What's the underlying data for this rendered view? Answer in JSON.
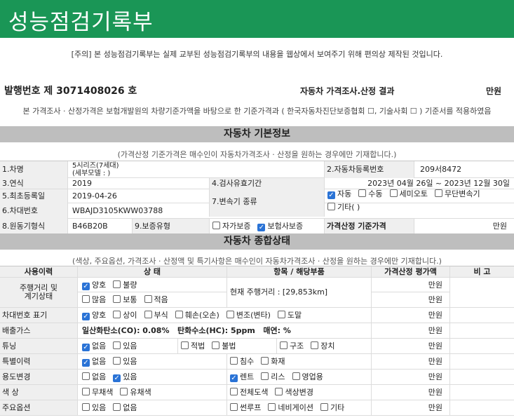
{
  "title": "성능점검기록부",
  "notice": "[주의] 본 성능점검기록부는 실제 교부된 성능점검기록부의 내용을 웹상에서 보여주기 위해 편의상 제작된 것입니다.",
  "issue_no": "발행번호 제 3071408026 호",
  "price_result_title": "자동차 가격조사.산정 결과",
  "won": "만원",
  "basis": "본 가격조사 · 산정가격은 보험개발원의 차량기준가액을 바탕으로 한 기준가격과 ( 한국자동차진단보증협회 ☐, 기술사회 ☐ ) 기준서를 적용하였음",
  "basic": {
    "title": "자동차 기본정보",
    "note": "(가격산정 기준가격은 매수인이 자동차가격조사 · 산정을 원하는 경우에만 기재합니다.)",
    "car_name_label": "1.차명",
    "car_name_1": "5시리즈(7세대)",
    "car_name_2": "(세부모델 : )",
    "reg_no_label": "2.자동차등록번호",
    "reg_no": "209서8472",
    "year_label": "3.연식",
    "year": "2019",
    "valid_label": "4.검사유효기간",
    "valid": "2023년 04월 26일 ~ 2023년 12월 30일",
    "first_reg_label": "5.최초등록일",
    "first_reg": "2019-04-26",
    "trans_label": "7.변속기 종류",
    "trans_opts": [
      {
        "t": "자동",
        "on": true
      },
      {
        "t": "수동",
        "on": false
      },
      {
        "t": "세미오토",
        "on": false
      },
      {
        "t": "무단변속기",
        "on": false
      },
      {
        "t": "기타( )",
        "on": false
      }
    ],
    "vin_label": "6.차대번호",
    "vin": "WBAJD3105KWW03788",
    "engine_label": "8.원동기형식",
    "engine": "B46B20B",
    "warranty_label": "9.보증유형",
    "warranty_opts": [
      {
        "t": "자가보증",
        "on": false
      },
      {
        "t": "보험사보증",
        "on": true
      }
    ],
    "base_price_label": "가격산정 기준가격",
    "base_price_unit": "만원"
  },
  "status": {
    "title": "자동차 종합상태",
    "note": "(색상, 주요옵션, 가격조사 · 산정액 및 특기사항은 매수인이 자동차가격조사 · 산정을 원하는 경우에만 기재합니다.)",
    "headers": [
      "사용이력",
      "상 태",
      "항목 / 해당부품",
      "가격산정 평가액",
      "비 고"
    ],
    "unit": "만원",
    "mileage_label_1": "주행거리 및",
    "mileage_label_2": "계기상태",
    "mileage_opts_a": [
      {
        "t": "양호",
        "on": true
      },
      {
        "t": "불량",
        "on": false
      }
    ],
    "mileage_opts_b": [
      {
        "t": "많음",
        "on": false
      },
      {
        "t": "보통",
        "on": false
      },
      {
        "t": "적음",
        "on": false
      }
    ],
    "mileage_text": "현재 주행거리 : [29,853km]",
    "vin_mark_label": "차대번호 표기",
    "vin_mark_opts": [
      {
        "t": "양호",
        "on": true
      },
      {
        "t": "상이",
        "on": false
      },
      {
        "t": "부식",
        "on": false
      },
      {
        "t": "훼손(오손)",
        "on": false
      },
      {
        "t": "변조(변타)",
        "on": false
      },
      {
        "t": "도말",
        "on": false
      }
    ],
    "emission_label": "배출가스",
    "emission_co": "일산화탄소(CO): 0.08%",
    "emission_hc": "탄화수소(HC): 5ppm",
    "emission_smoke": "매연: %",
    "tuning_label": "튜닝",
    "tuning_a": [
      {
        "t": "없음",
        "on": true
      },
      {
        "t": "있음",
        "on": false
      }
    ],
    "tuning_b": [
      {
        "t": "적법",
        "on": false
      },
      {
        "t": "불법",
        "on": false
      }
    ],
    "tuning_c": [
      {
        "t": "구조",
        "on": false
      },
      {
        "t": "장치",
        "on": false
      }
    ],
    "special_label": "특별이력",
    "special_a": [
      {
        "t": "없음",
        "on": true
      },
      {
        "t": "있음",
        "on": false
      }
    ],
    "special_b": [
      {
        "t": "침수",
        "on": false
      },
      {
        "t": "화재",
        "on": false
      }
    ],
    "use_label": "용도변경",
    "use_a": [
      {
        "t": "없음",
        "on": false
      },
      {
        "t": "있음",
        "on": true
      }
    ],
    "use_b": [
      {
        "t": "렌트",
        "on": true
      },
      {
        "t": "리스",
        "on": false
      },
      {
        "t": "영업용",
        "on": false
      }
    ],
    "color_label": "색 상",
    "color_a": [
      {
        "t": "무채색",
        "on": false
      },
      {
        "t": "유채색",
        "on": false
      }
    ],
    "color_b": [
      {
        "t": "전체도색",
        "on": false
      },
      {
        "t": "색상변경",
        "on": false
      }
    ],
    "option_label": "주요옵션",
    "option_a": [
      {
        "t": "있음",
        "on": false
      },
      {
        "t": "없음",
        "on": false
      }
    ],
    "option_b": [
      {
        "t": "썬루프",
        "on": false
      },
      {
        "t": "네비게이션",
        "on": false
      },
      {
        "t": "기타",
        "on": false
      }
    ]
  }
}
